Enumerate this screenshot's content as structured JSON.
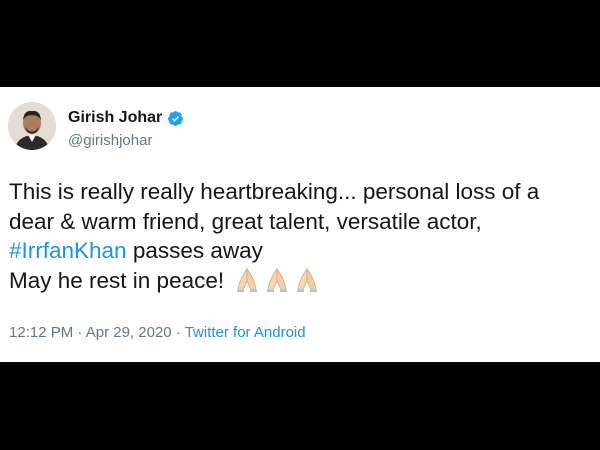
{
  "tweet": {
    "author": {
      "name": "Girish Johar",
      "handle": "@girishjohar",
      "verified": true
    },
    "text_lines": [
      "This is really really heartbreaking... personal loss of a",
      "dear & warm friend, great talent, versatile actor,"
    ],
    "hashtag": "#IrrfanKhan",
    "hashtag_suffix": " passes away",
    "last_line": "May he rest in peace!",
    "emojis": [
      "folded-hands",
      "folded-hands",
      "folded-hands"
    ],
    "time": "12:12 PM",
    "separator": " · ",
    "date": "Apr 29, 2020",
    "source": "Twitter for Android",
    "colors": {
      "link": "#1b95e0",
      "text": "#14171a",
      "muted": "#657786",
      "background": "#000000"
    }
  }
}
